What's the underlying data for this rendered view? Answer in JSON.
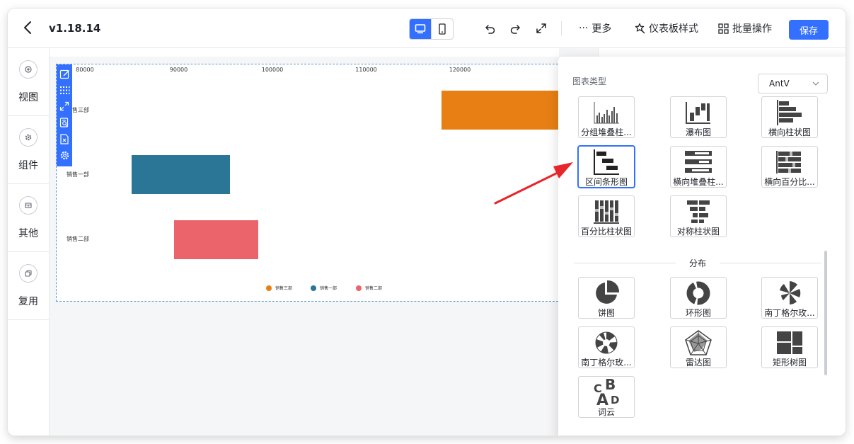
{
  "header": {
    "version": "v1.18.14",
    "more_label": "更多",
    "dashboard_style_label": "仪表板样式",
    "batch_label": "批量操作",
    "save_label": "保存"
  },
  "sidebar": {
    "items": [
      {
        "label": "视图",
        "icon": "add-circle-icon"
      },
      {
        "label": "组件",
        "icon": "gear-icon"
      },
      {
        "label": "其他",
        "icon": "box-icon"
      },
      {
        "label": "复用",
        "icon": "copy-icon"
      }
    ]
  },
  "chart_data": {
    "type": "bar",
    "orientation": "horizontal-range",
    "categories": [
      "销售三部",
      "销售一部",
      "销售二部"
    ],
    "ranges": [
      [
        118000,
        132000
      ],
      [
        85000,
        95500
      ],
      [
        89500,
        98500
      ]
    ],
    "x_ticks": [
      "80000",
      "90000",
      "100000",
      "110000",
      "120000"
    ],
    "xlim": [
      80000,
      132000
    ],
    "colors": [
      "#e87f14",
      "#2b7596",
      "#ec646b"
    ],
    "legend": [
      "销售三部",
      "销售一部",
      "销售二部"
    ],
    "legend_position": "bottom"
  },
  "popover": {
    "title": "图表类型",
    "library": "AntV",
    "section_distribution": "分布",
    "tiles_bar": [
      {
        "label": "分组堆叠柱...",
        "icon": "grouped-stacked-bar-icon"
      },
      {
        "label": "瀑布图",
        "icon": "waterfall-icon"
      },
      {
        "label": "横向柱状图",
        "icon": "horizontal-bar-icon"
      },
      {
        "label": "区间条形图",
        "icon": "range-bar-icon",
        "selected": true
      },
      {
        "label": "横向堆叠柱...",
        "icon": "horizontal-stacked-bar-icon"
      },
      {
        "label": "横向百分比...",
        "icon": "horizontal-percent-bar-icon"
      },
      {
        "label": "百分比柱状图",
        "icon": "percent-bar-icon"
      },
      {
        "label": "对称柱状图",
        "icon": "symmetric-bar-icon"
      }
    ],
    "tiles_distribution": [
      {
        "label": "饼图",
        "icon": "pie-icon"
      },
      {
        "label": "环形图",
        "icon": "donut-icon"
      },
      {
        "label": "南丁格尔玫...",
        "icon": "nightingale-rose-icon"
      },
      {
        "label": "南丁格尔玫...",
        "icon": "nightingale-rose-alt-icon"
      },
      {
        "label": "雷达图",
        "icon": "radar-icon"
      },
      {
        "label": "矩形树图",
        "icon": "treemap-icon"
      },
      {
        "label": "词云",
        "icon": "word-cloud-icon"
      }
    ]
  },
  "colors": {
    "accent": "#3370ff",
    "annotation_arrow": "#e8252a"
  }
}
